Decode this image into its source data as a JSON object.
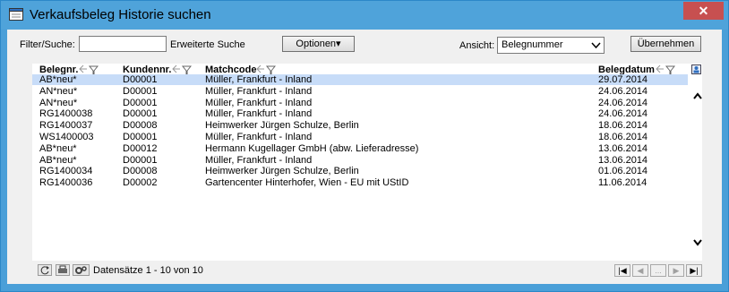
{
  "window": {
    "title": "Verkaufsbeleg Historie suchen",
    "close_label": "✕"
  },
  "toolbar": {
    "filter_label": "Filter/Suche:",
    "filter_value": "",
    "advanced_search_label": "Erweiterte Suche",
    "options_label": "Optionen▾",
    "view_label": "Ansicht:",
    "view_selected": "Belegnummer",
    "apply_label": "Übernehmen"
  },
  "table": {
    "columns": [
      "Belegnr.",
      "Kundennr.",
      "Matchcode",
      "Belegdatum"
    ],
    "rows": [
      {
        "belegnr": "AB*neu*",
        "kundennr": "D00001",
        "matchcode": "Müller, Frankfurt - Inland",
        "datum": "29.07.2014",
        "selected": true
      },
      {
        "belegnr": "AN*neu*",
        "kundennr": "D00001",
        "matchcode": "Müller, Frankfurt - Inland",
        "datum": "24.06.2014"
      },
      {
        "belegnr": "AN*neu*",
        "kundennr": "D00001",
        "matchcode": "Müller, Frankfurt - Inland",
        "datum": "24.06.2014"
      },
      {
        "belegnr": "RG1400038",
        "kundennr": "D00001",
        "matchcode": "Müller, Frankfurt - Inland",
        "datum": "24.06.2014"
      },
      {
        "belegnr": "RG1400037",
        "kundennr": "D00008",
        "matchcode": "Heimwerker Jürgen Schulze, Berlin",
        "datum": "18.06.2014"
      },
      {
        "belegnr": "WS1400003",
        "kundennr": "D00001",
        "matchcode": "Müller, Frankfurt - Inland",
        "datum": "18.06.2014"
      },
      {
        "belegnr": "AB*neu*",
        "kundennr": "D00012",
        "matchcode": "Hermann Kugellager GmbH (abw. Lieferadresse)",
        "datum": "13.06.2014"
      },
      {
        "belegnr": "AB*neu*",
        "kundennr": "D00001",
        "matchcode": "Müller, Frankfurt - Inland",
        "datum": "13.06.2014"
      },
      {
        "belegnr": "RG1400034",
        "kundennr": "D00008",
        "matchcode": "Heimwerker Jürgen Schulze, Berlin",
        "datum": "01.06.2014"
      },
      {
        "belegnr": "RG1400036",
        "kundennr": "D00002",
        "matchcode": "Gartencenter Hinterhofer, Wien - EU mit UStID",
        "datum": "11.06.2014"
      }
    ]
  },
  "footer": {
    "records_text": "Datensätze 1 - 10 von 10",
    "pager": [
      "|◀",
      "◀",
      "...",
      "▶",
      "▶|"
    ]
  },
  "colors": {
    "title_bar": "#4fa3da",
    "selected_row": "#c7dcf8",
    "close_button": "#c75050"
  }
}
